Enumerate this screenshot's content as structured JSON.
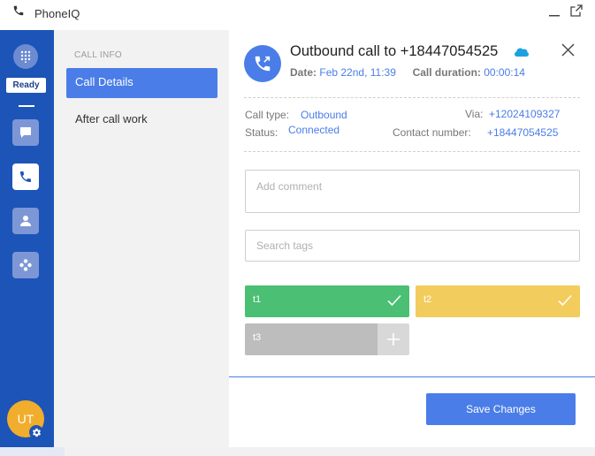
{
  "window": {
    "title": "PhoneIQ",
    "icon": "phone-icon"
  },
  "rail": {
    "status": "Ready",
    "avatar_initials": "UT",
    "items": [
      {
        "icon": "chat-icon"
      },
      {
        "icon": "phone-icon",
        "active": true
      },
      {
        "icon": "contact-icon"
      },
      {
        "icon": "apps-icon"
      }
    ]
  },
  "subnav": {
    "section_label": "CALL INFO",
    "items": [
      {
        "label": "Call Details",
        "active": true
      },
      {
        "label": "After call work"
      }
    ]
  },
  "call": {
    "title": "Outbound call to +18447054525",
    "date_label": "Date:",
    "date_value": "Feb 22nd, 11:39",
    "duration_label": "Call duration:",
    "duration_value": "00:00:14",
    "call_type_label": "Call type:",
    "call_type_value": "Outbound",
    "via_label": "Via:",
    "via_value": "+12024109327",
    "status_label": "Status:",
    "status_value": "Connected",
    "contact_label": "Contact number:",
    "contact_value": "+18447054525"
  },
  "form": {
    "comment_placeholder": "Add comment",
    "tags_placeholder": "Search tags"
  },
  "tags": [
    {
      "label": "t1",
      "color": "#4bbf74",
      "selected": true
    },
    {
      "label": "t2",
      "color": "#f2cc5c",
      "selected": true
    },
    {
      "label": "t3",
      "color": "#bdbdbd",
      "selected": false
    }
  ],
  "footer": {
    "save_label": "Save Changes"
  },
  "colors": {
    "accent": "#4a7de8",
    "rail": "#1d54b8",
    "avatar": "#f1ad2c"
  }
}
